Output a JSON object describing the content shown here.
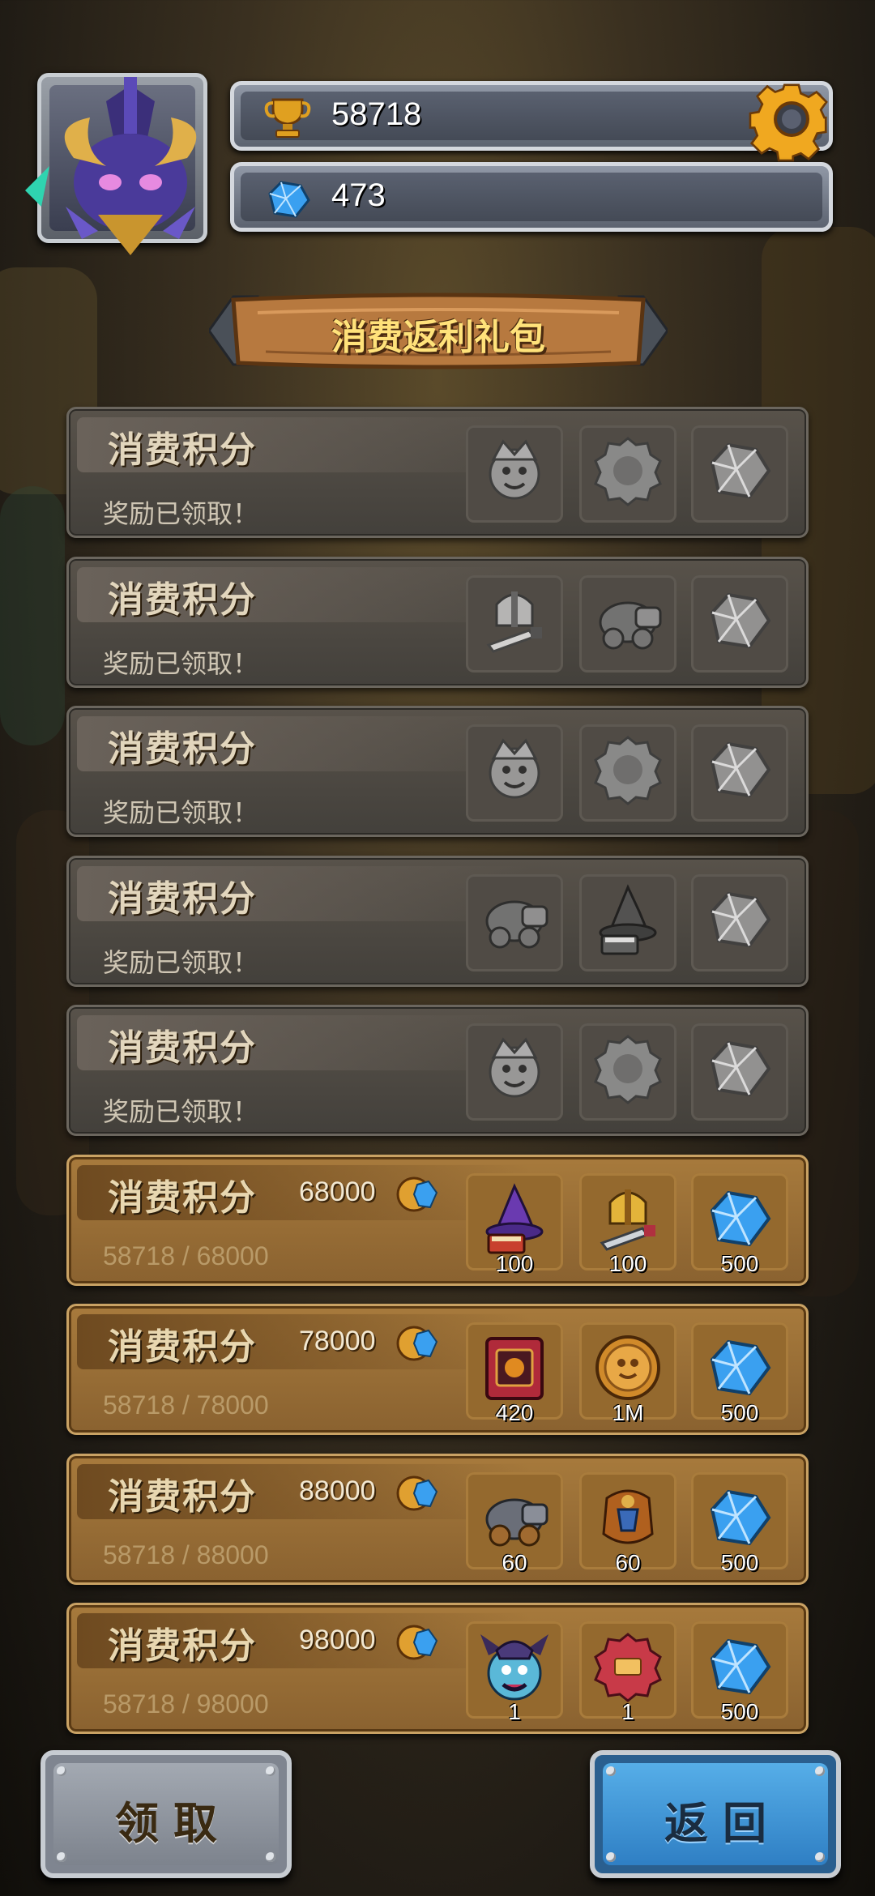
{
  "header": {
    "gold": "58718",
    "gems": "473"
  },
  "title": "消费返利礼包",
  "tiers": [
    {
      "label": "消费积分",
      "status": "奖励已领取！",
      "rewards": [
        {
          "icon": "hero-portrait-icon"
        },
        {
          "icon": "token-icon"
        },
        {
          "icon": "gem-icon"
        }
      ]
    },
    {
      "label": "消费积分",
      "status": "奖励已领取！",
      "rewards": [
        {
          "icon": "helmet-sword-icon"
        },
        {
          "icon": "cannon-icon"
        },
        {
          "icon": "gem-icon"
        }
      ]
    },
    {
      "label": "消费积分",
      "status": "奖励已领取！",
      "rewards": [
        {
          "icon": "hero-portrait-icon"
        },
        {
          "icon": "token-icon"
        },
        {
          "icon": "gem-icon"
        }
      ]
    },
    {
      "label": "消费积分",
      "status": "奖励已领取！",
      "rewards": [
        {
          "icon": "cannon-icon"
        },
        {
          "icon": "wizard-hat-icon"
        },
        {
          "icon": "gem-icon"
        }
      ]
    },
    {
      "label": "消费积分",
      "status": "奖励已领取！",
      "rewards": [
        {
          "icon": "hero-portrait-icon"
        },
        {
          "icon": "token-icon"
        },
        {
          "icon": "gem-icon"
        }
      ]
    },
    {
      "label": "消费积分",
      "threshold": "68000",
      "progress": "58718 / 68000",
      "rewards": [
        {
          "icon": "wizard-hat-icon",
          "qty": "100"
        },
        {
          "icon": "helmet-sword-icon",
          "qty": "100"
        },
        {
          "icon": "gem-icon",
          "qty": "500"
        }
      ]
    },
    {
      "label": "消费积分",
      "threshold": "78000",
      "progress": "58718 / 78000",
      "rewards": [
        {
          "icon": "spellbook-icon",
          "qty": "420"
        },
        {
          "icon": "gold-coin-icon",
          "qty": "1M"
        },
        {
          "icon": "gem-icon",
          "qty": "500"
        }
      ]
    },
    {
      "label": "消费积分",
      "threshold": "88000",
      "progress": "58718 / 88000",
      "rewards": [
        {
          "icon": "cannon-icon",
          "qty": "60"
        },
        {
          "icon": "armor-icon",
          "qty": "60"
        },
        {
          "icon": "gem-icon",
          "qty": "500"
        }
      ]
    },
    {
      "label": "消费积分",
      "threshold": "98000",
      "progress": "58718 / 98000",
      "rewards": [
        {
          "icon": "demon-hero-icon",
          "qty": "1"
        },
        {
          "icon": "red-token-icon",
          "qty": "1"
        },
        {
          "icon": "gem-icon",
          "qty": "500"
        }
      ]
    }
  ],
  "buttons": {
    "claim": "领取",
    "back": "返回"
  },
  "colors": {
    "gold_text": "#ffe27a",
    "active_row": "#a77a3c",
    "claimed_row": "#58524a",
    "back_button": "#3f95d8",
    "gem": "#3aa0f0"
  }
}
